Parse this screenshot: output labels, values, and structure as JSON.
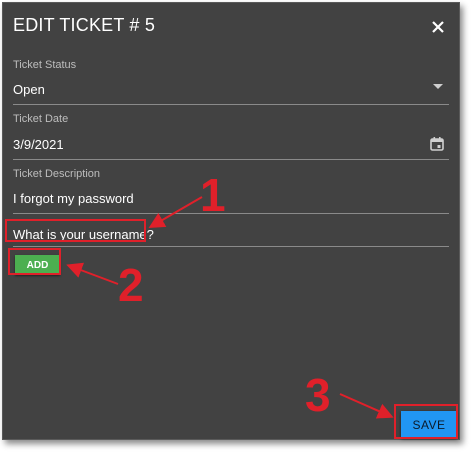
{
  "dialog": {
    "title": "EDIT TICKET # 5",
    "close_icon": "close-icon"
  },
  "fields": {
    "status": {
      "label": "Ticket Status",
      "value": "Open",
      "icon": "dropdown-arrow-icon"
    },
    "date": {
      "label": "Ticket Date",
      "value": "3/9/2021",
      "icon": "calendar-icon"
    },
    "description": {
      "label": "Ticket Description",
      "value": "I forgot my password"
    }
  },
  "question": {
    "value": "What is your username?"
  },
  "buttons": {
    "add_label": "ADD",
    "save_label": "SAVE"
  },
  "callouts": [
    "1",
    "2",
    "3"
  ],
  "colors": {
    "background": "#424242",
    "annotation": "#e0202a",
    "add_button": "#4caf50",
    "save_button": "#2196f3"
  }
}
